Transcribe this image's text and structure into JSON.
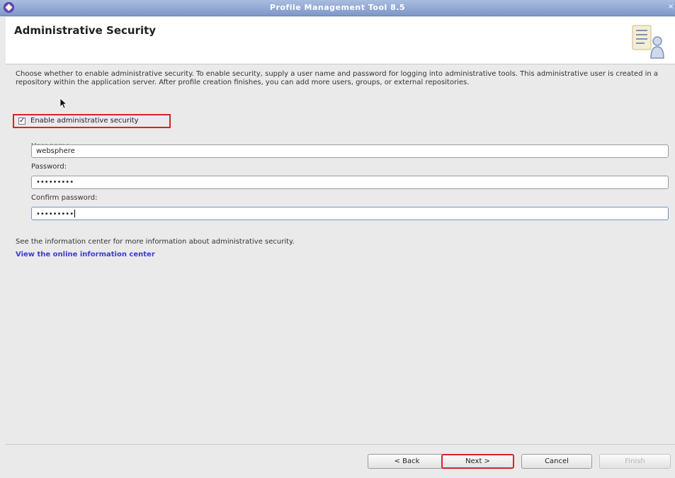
{
  "window": {
    "title": "Profile Management Tool 8.5"
  },
  "banner": {
    "title": "Administrative Security",
    "icon": "wizard-page-icon"
  },
  "description": "Choose whether to enable administrative security. To enable security, supply a user name and password for logging into administrative tools. This administrative user is created in a repository within the application server. After profile creation finishes, you can add more users, groups, or external repositories.",
  "security": {
    "enable_label": "Enable administrative security",
    "enabled": true
  },
  "fields": {
    "username": {
      "label": "User name:",
      "value": "websphere"
    },
    "password": {
      "label": "Password:",
      "value": "•••••••••"
    },
    "confirm": {
      "label": "Confirm password:",
      "value": "•••••••••"
    }
  },
  "info": {
    "text": "See the information center for more information about administrative security.",
    "link": "View the online information center"
  },
  "buttons": {
    "back": "< Back",
    "next": "Next >",
    "cancel": "Cancel",
    "finish": "Finish"
  },
  "colors": {
    "highlight": "#d9222a",
    "link": "#3b3bd0",
    "titlebar": "#8fa6d4"
  }
}
